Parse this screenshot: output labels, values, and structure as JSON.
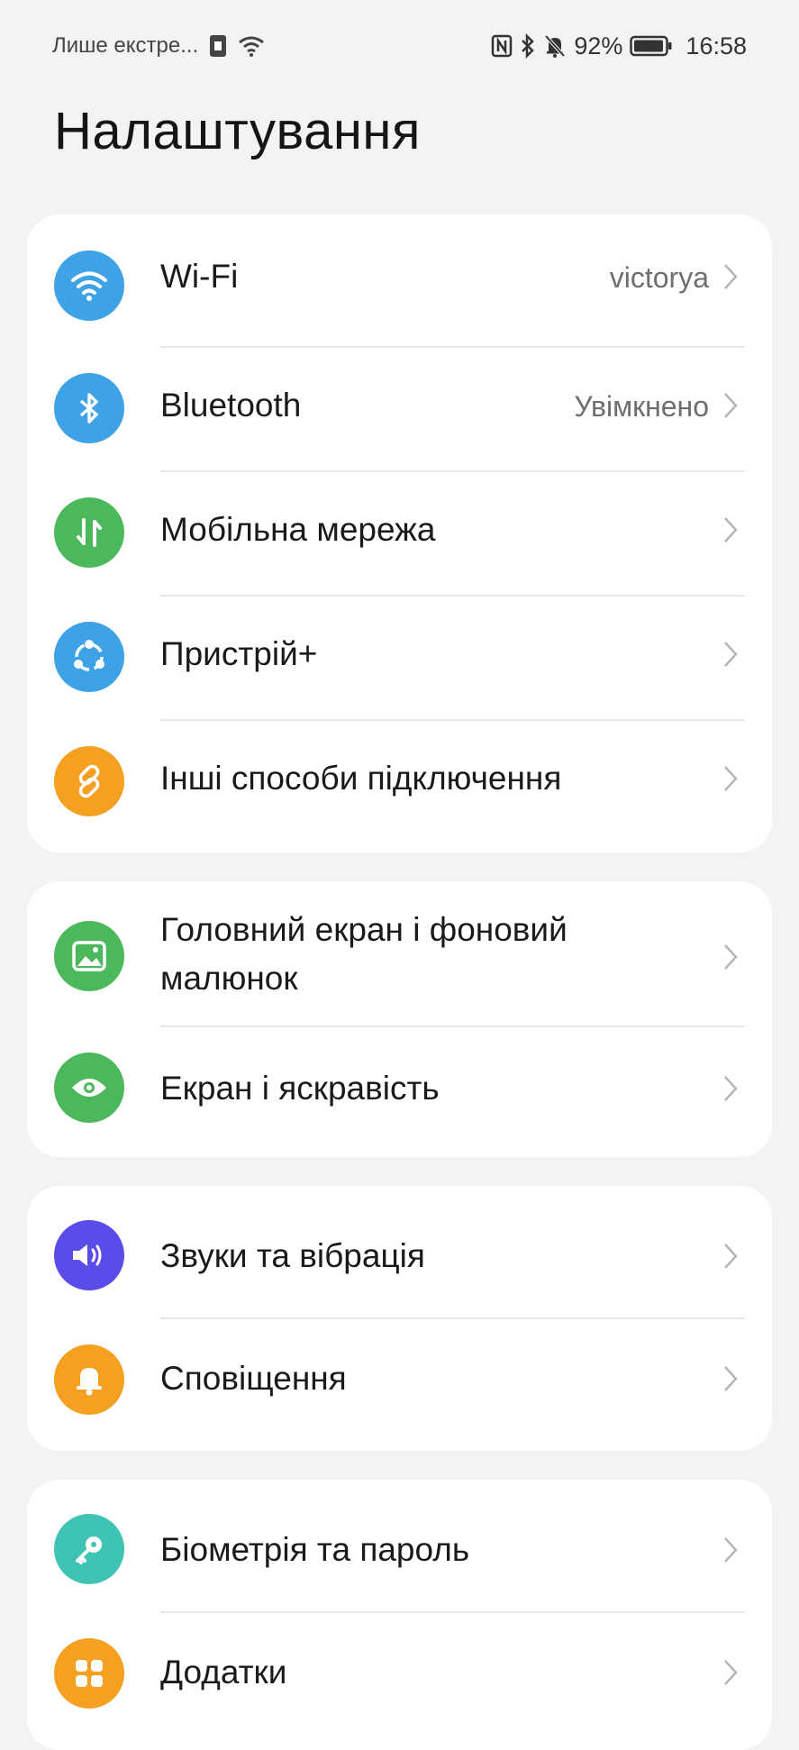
{
  "status_bar": {
    "carrier_text": "Лише екстре...",
    "battery_percent": "92%",
    "time": "16:58",
    "icons": [
      "sim-icon",
      "wifi-icon",
      "nfc-icon",
      "bluetooth-icon",
      "silent-bell-icon",
      "battery-icon"
    ]
  },
  "page": {
    "title": "Налаштування"
  },
  "groups": [
    {
      "items": [
        {
          "label": "Wi-Fi",
          "value": "victorya",
          "icon": "wifi-icon",
          "color": "#3ea3e6"
        },
        {
          "label": "Bluetooth",
          "value": "Увімкнено",
          "icon": "bluetooth-icon",
          "color": "#3ea3e6"
        },
        {
          "label": "Мобільна мережа",
          "icon": "mobile-data-icon",
          "color": "#4cb85c"
        },
        {
          "label": "Пристрій+",
          "icon": "device-plus-icon",
          "color": "#3ea3e6"
        },
        {
          "label": "Інші способи підключення",
          "icon": "link-icon",
          "color": "#f5a021"
        }
      ]
    },
    {
      "items": [
        {
          "label_line1": "Головний екран і фоновий",
          "label_line2": "малюнок",
          "icon": "wallpaper-icon",
          "color": "#4cb85c"
        },
        {
          "label": "Екран і яскравість",
          "icon": "eye-icon",
          "color": "#4cb85c"
        }
      ]
    },
    {
      "items": [
        {
          "label": "Звуки та вібрація",
          "icon": "speaker-icon",
          "color": "#5a4ce8"
        },
        {
          "label": "Сповіщення",
          "icon": "bell-icon",
          "color": "#f5a021"
        }
      ]
    },
    {
      "items": [
        {
          "label": "Біометрія та пароль",
          "icon": "key-icon",
          "color": "#3fc4b4"
        },
        {
          "label": "Додатки",
          "icon": "apps-icon",
          "color": "#f5a021"
        }
      ]
    }
  ]
}
